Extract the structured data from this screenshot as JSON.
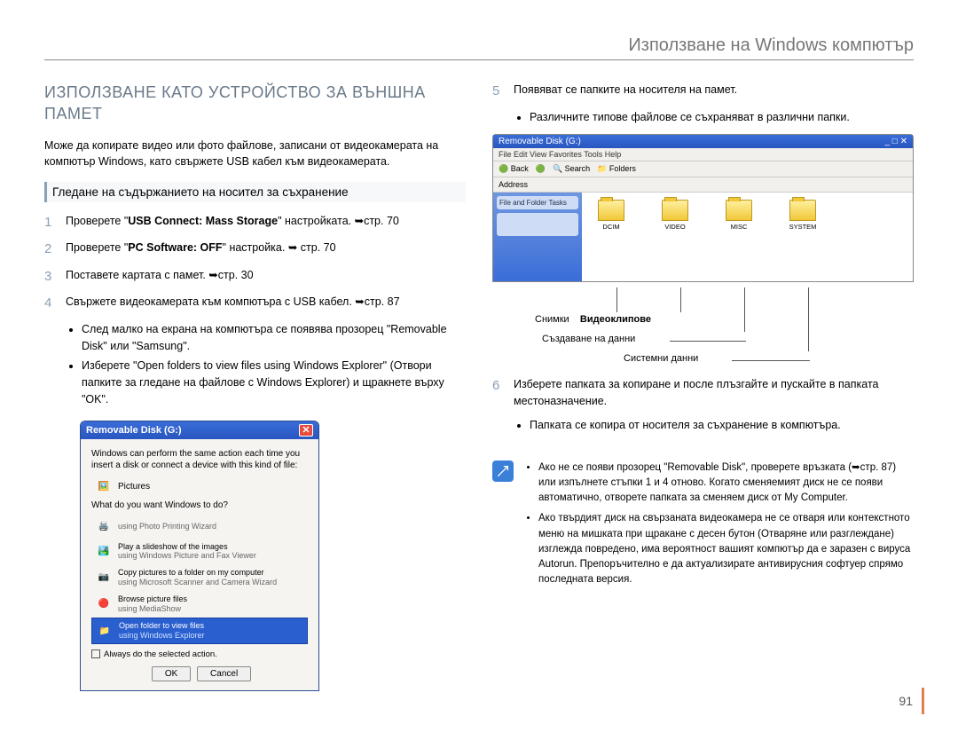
{
  "header": {
    "title": "Използване на Windows компютър"
  },
  "section_title": "ИЗПОЛЗВАНЕ КАТО УСТРОЙСТВО ЗА ВЪНШНА ПАМЕТ",
  "intro": "Може да копирате видео или фото файлове, записани от видеокамерата на компютър Windows, като свържете USB кабел към видеокамерата.",
  "subheading": "Гледане на съдържанието на носител за съхранение",
  "step1": {
    "num": "1",
    "pre": "Проверете \"",
    "bold": "USB Connect: Mass Storage",
    "post": "\" настройката. ➥стр. 70"
  },
  "step2": {
    "num": "2",
    "pre": "Проверете \"",
    "bold": "PC Software: OFF",
    "post": "\" настройка. ➥ стр. 70"
  },
  "step3": {
    "num": "3",
    "text": "Поставете картата с памет. ➥стр. 30"
  },
  "step4": {
    "num": "4",
    "text": "Свържете видеокамерата към компютъра с USB кабел. ➥стр. 87"
  },
  "step4_b1": "След малко на екрана на компютъра се появява прозорец \"Removable Disk\" или \"Samsung\".",
  "step4_b2": "Изберете \"Open folders to view files using Windows Explorer\" (Отвори папките за гледане на файлове с Windows Explorer) и щракнете върху \"OK\".",
  "dialog": {
    "title": "Removable Disk (G:)",
    "msg1": "Windows can perform the same action each time you insert a disk or connect a device with this kind of file:",
    "type_label": "Pictures",
    "question": "What do you want Windows to do?",
    "opt1": "using Photo Printing Wizard",
    "opt2a": "Play a slideshow of the images",
    "opt2b": "using Windows Picture and Fax Viewer",
    "opt3a": "Copy pictures to a folder on my computer",
    "opt3b": "using Microsoft Scanner and Camera Wizard",
    "opt4a": "Browse picture files",
    "opt4b": "using MediaShow",
    "opt5a": "Open folder to view files",
    "opt5b": "using Windows Explorer",
    "checkbox": "Always do the selected action.",
    "ok": "OK",
    "cancel": "Cancel"
  },
  "step5": {
    "num": "5",
    "text": "Появяват се папките на носителя на памет."
  },
  "step5_b1": "Различните типове файлове се съхраняват в различни папки.",
  "explorer": {
    "menu": "File   Edit   View   Favorites   Tools   Help",
    "tool_back": "Back",
    "tool_search": "Search",
    "tool_folders": "Folders",
    "addr": "Address",
    "side_title": "File and Folder Tasks",
    "folders": [
      "DCIM",
      "VIDEO",
      "MISC",
      "SYSTEM"
    ]
  },
  "callouts": {
    "photos": "Снимки",
    "videos": "Видеоклипове",
    "data_create": "Създаване на данни",
    "sys_data": "Системни данни"
  },
  "step6": {
    "num": "6",
    "text": "Изберете папката за копиране и после плъзгайте и пускайте в папката местоназначение."
  },
  "step6_b1": "Папката се копира от носителя за съхранение в компютъра.",
  "note1": "Ако не се появи прозорец \"Removable Disk\", проверете връзката (➥стр. 87) или изпълнете стъпки 1 и 4 отново. Когато сменяемият диск не се появи автоматично, отворете папката за сменяем диск от My Computer.",
  "note2": "Ако твърдият диск на свързаната видеокамера не се отваря или контекстното меню на мишката при щракане с десен бутон (Отваряне или разглеждане) изглежда повредено, има вероятност вашият компютър да е заразен с вируса Autorun. Препоръчително е да актуализирате антивирусния софтуер спрямо последната версия.",
  "page_number": "91"
}
